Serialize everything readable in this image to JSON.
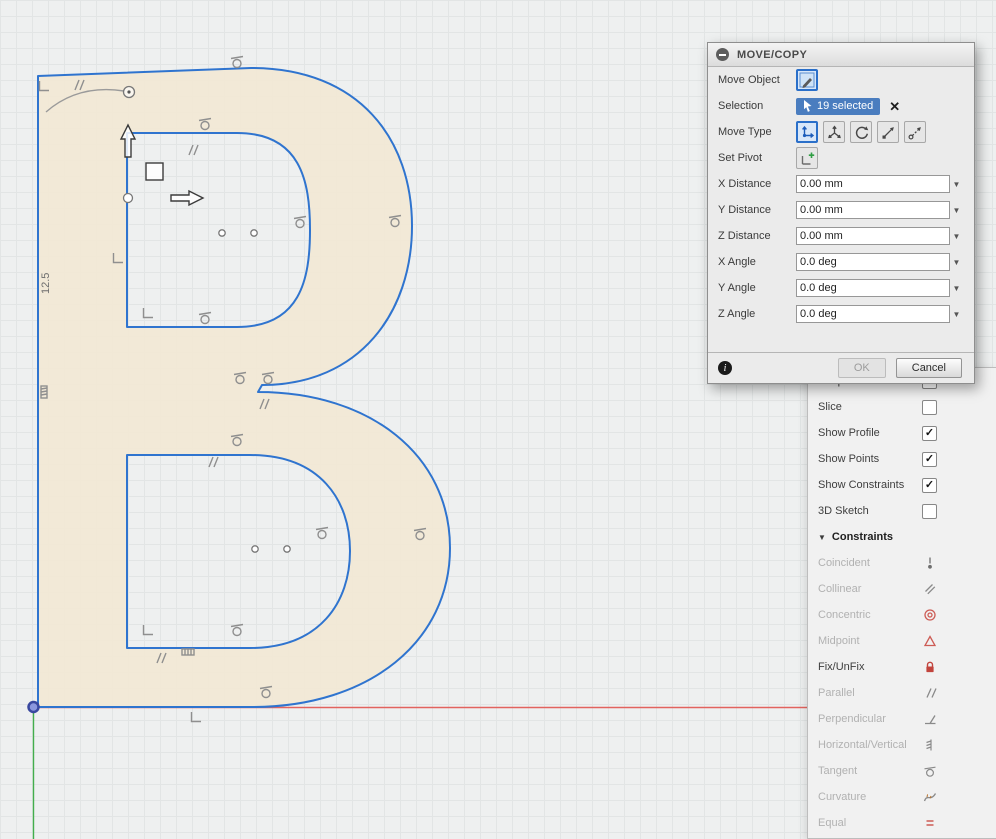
{
  "canvas": {
    "dimension_label": "12.5"
  },
  "dialog": {
    "title": "MOVE/COPY",
    "move_object_label": "Move Object",
    "selection_label": "Selection",
    "selection_badge": "19 selected",
    "move_type_label": "Move Type",
    "set_pivot_label": "Set Pivot",
    "inputs": [
      {
        "label": "X Distance",
        "value": "0.00 mm"
      },
      {
        "label": "Y Distance",
        "value": "0.00 mm"
      },
      {
        "label": "Z Distance",
        "value": "0.00 mm"
      },
      {
        "label": "X Angle",
        "value": "0.0 deg"
      },
      {
        "label": "Y Angle",
        "value": "0.0 deg"
      },
      {
        "label": "Z Angle",
        "value": "0.0 deg"
      }
    ],
    "ok_label": "OK",
    "cancel_label": "Cancel"
  },
  "palette": {
    "options": [
      {
        "label": "Snap",
        "check": "✓"
      },
      {
        "label": "Slice",
        "check": ""
      },
      {
        "label": "Show Profile",
        "check": "✓"
      },
      {
        "label": "Show Points",
        "check": "✓"
      },
      {
        "label": "Show Constraints",
        "check": "✓"
      },
      {
        "label": "3D Sketch",
        "check": ""
      }
    ],
    "constraints_header": "Constraints",
    "constraints": [
      {
        "label": "Coincident",
        "icon": "coincident-icon"
      },
      {
        "label": "Collinear",
        "icon": "collinear-icon"
      },
      {
        "label": "Concentric",
        "icon": "concentric-icon"
      },
      {
        "label": "Midpoint",
        "icon": "midpoint-icon"
      },
      {
        "label": "Fix/UnFix",
        "icon": "lock-icon"
      },
      {
        "label": "Parallel",
        "icon": "parallel-icon"
      },
      {
        "label": "Perpendicular",
        "icon": "perpendicular-icon"
      },
      {
        "label": "Horizontal/Vertical",
        "icon": "horizontal-vertical-icon"
      },
      {
        "label": "Tangent",
        "icon": "tangent-icon"
      },
      {
        "label": "Curvature",
        "icon": "curvature-icon"
      },
      {
        "label": "Equal",
        "icon": "equal-icon"
      }
    ]
  },
  "colors": {
    "selection_fill": "#f2e8d5",
    "sketch_line": "#2f74cf",
    "accent_blue": "#4a7dbf",
    "axis_red": "#e2635e",
    "axis_green": "#43ae4c"
  }
}
